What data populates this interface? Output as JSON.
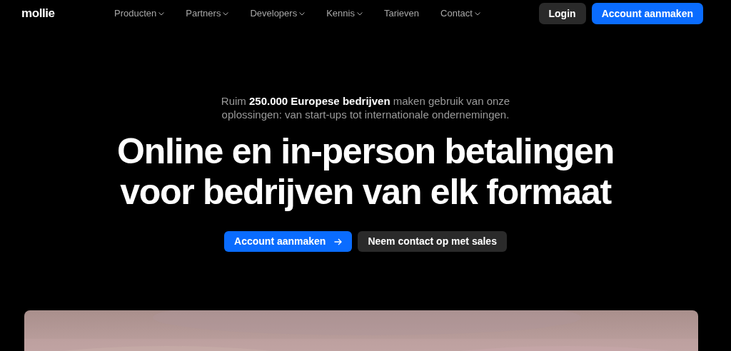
{
  "header": {
    "logo": "mollie",
    "nav": [
      {
        "label": "Producten",
        "kind": "dropdown"
      },
      {
        "label": "Partners",
        "kind": "dropdown"
      },
      {
        "label": "Developers",
        "kind": "dropdown"
      },
      {
        "label": "Kennis",
        "kind": "dropdown"
      },
      {
        "label": "Tarieven",
        "kind": "link"
      },
      {
        "label": "Contact",
        "kind": "dropdown"
      }
    ],
    "login": "Login",
    "signup": "Account aanmaken"
  },
  "hero": {
    "intro": "Ruim **250.000 Europese bedrijven** maken gebruik van onze oplossingen: van start-ups tot internationale ondernemingen.",
    "heading": "Online en in-person betalingen voor bedrijven van elk formaat",
    "buttons": [
      {
        "label": "Account aanmaken",
        "kind": "primary"
      },
      {
        "label": "Neem contact op met sales",
        "kind": "secondary"
      }
    ]
  }
}
